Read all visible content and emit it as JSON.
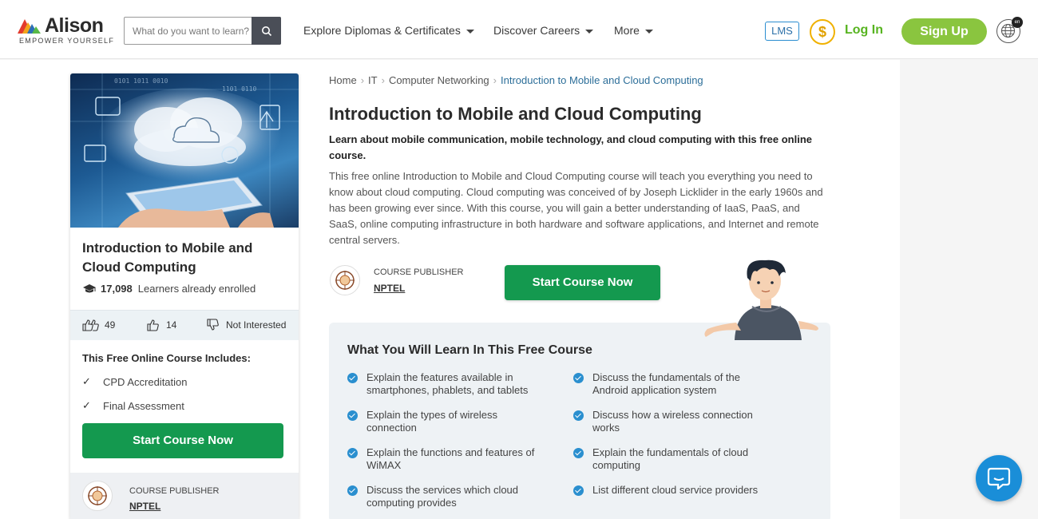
{
  "header": {
    "logo_name": "Alison",
    "logo_tagline": "EMPOWER YOURSELF",
    "search_placeholder": "What do you want to learn?",
    "nav": {
      "diplomas": "Explore Diplomas & Certificates",
      "careers": "Discover Careers",
      "more": "More"
    },
    "lms": "LMS",
    "coin_symbol": "$",
    "login": "Log In",
    "signup": "Sign Up",
    "globe_badge": "en"
  },
  "card": {
    "title": "Introduction to Mobile and Cloud Computing",
    "enrolled_count": "17,098",
    "enrolled_text": "Learners already enrolled",
    "likes": "49",
    "thumbs": "14",
    "not_interested": "Not Interested",
    "includes_title": "This Free Online Course Includes:",
    "includes": [
      "CPD Accreditation",
      "Final Assessment"
    ],
    "start_button": "Start Course Now",
    "publisher_label": "COURSE PUBLISHER",
    "publisher_name": "NPTEL"
  },
  "breadcrumb": {
    "home": "Home",
    "it": "IT",
    "networking": "Computer Networking",
    "current": "Introduction to Mobile and Cloud Computing"
  },
  "course": {
    "title": "Introduction to Mobile and Cloud Computing",
    "lead": "Learn about mobile communication, mobile technology, and cloud computing with this free online course.",
    "description": "This free online Introduction to Mobile and Cloud Computing course will teach you everything you need to know about cloud computing. Cloud computing was conceived of by Joseph Licklider in the early 1960s and has been growing ever since. With this course, you will gain a better understanding of IaaS, PaaS, and SaaS, online computing infrastructure in both hardware and software applications, and Internet and remote central servers.",
    "publisher_label": "COURSE PUBLISHER",
    "publisher_name": "NPTEL",
    "start_button": "Start Course Now"
  },
  "learn": {
    "title": "What You Will Learn In This Free Course",
    "left": [
      "Explain the features available in smartphones, phablets, and tablets",
      "Explain the types of wireless connection",
      "Explain the functions and features of WiMAX",
      "Discuss the services which cloud computing provides"
    ],
    "right": [
      "Discuss the fundamentals of the Android application system",
      "Discuss how a wireless connection works",
      "Explain the fundamentals of cloud computing",
      "List different cloud service providers"
    ]
  },
  "colors": {
    "primary_green": "#14994f",
    "signup_green": "#8ac53f",
    "link_blue": "#2c6e99",
    "check_blue": "#2a8fcf",
    "chat_blue": "#1a8ed8"
  }
}
